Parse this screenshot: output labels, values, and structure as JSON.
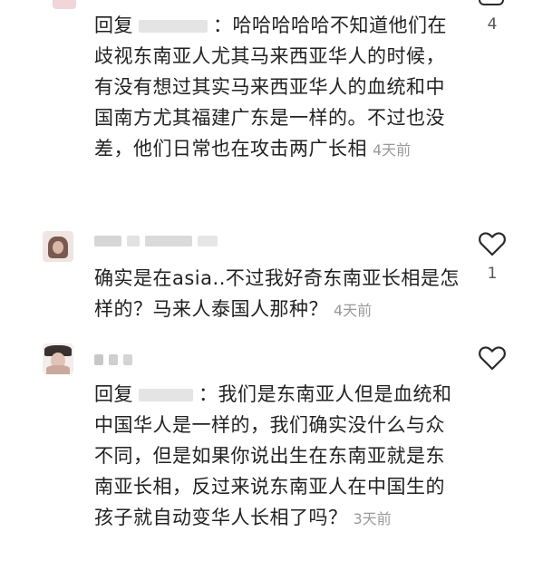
{
  "comments": [
    {
      "reply_prefix": "回复",
      "text": "：哈哈哈哈哈不知道他们在歧视东南亚人尤其马来西亚华人的时候，有没有想过其实马来西亚华人的血统和中国南方尤其福建广东是一样的。不过也没差，他们日常也在攻击两广长相",
      "time": "4天前",
      "likes": "4"
    },
    {
      "text": "确实是在asia..不过我好奇东南亚长相是怎样的？马来人泰国人那种？",
      "time": "4天前",
      "likes": "1"
    },
    {
      "reply_prefix": "回复",
      "text": "：我们是东南亚人但是血统和中国华人是一样的，我们确实没什么与众不同，但是如果你说出生在东南亚就是东南亚长相，反过来说东南亚人在中国生的孩子就自动变华人长相了吗？",
      "time": "3天前"
    }
  ],
  "icons": {
    "like": "heart-outline-icon"
  },
  "colors": {
    "text": "#222222",
    "time": "#9a9a9a",
    "background": "#ffffff"
  }
}
